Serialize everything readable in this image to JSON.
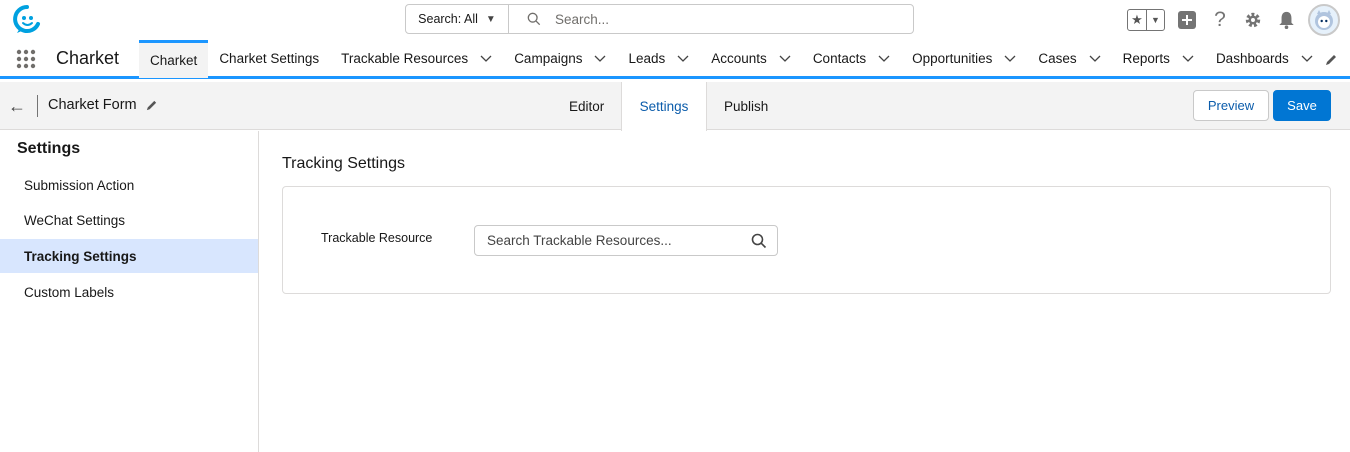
{
  "global_header": {
    "search_scope": "Search: All",
    "search_placeholder": "Search...",
    "icons": [
      "favorites-star-icon",
      "favorites-dropdown-icon",
      "global-add-icon",
      "help-icon",
      "setup-gear-icon",
      "notifications-bell-icon",
      "user-avatar"
    ]
  },
  "nav": {
    "app_name": "Charket",
    "items": [
      {
        "label": "Charket",
        "active": true,
        "dropdown": false
      },
      {
        "label": "Charket Settings",
        "dropdown": false
      },
      {
        "label": "Trackable Resources",
        "dropdown": true
      },
      {
        "label": "Campaigns",
        "dropdown": true
      },
      {
        "label": "Leads",
        "dropdown": true
      },
      {
        "label": "Accounts",
        "dropdown": true
      },
      {
        "label": "Contacts",
        "dropdown": true
      },
      {
        "label": "Opportunities",
        "dropdown": true
      },
      {
        "label": "Cases",
        "dropdown": true
      },
      {
        "label": "Reports",
        "dropdown": true
      },
      {
        "label": "Dashboards",
        "dropdown": true
      }
    ]
  },
  "builder": {
    "form_title": "Charket Form",
    "tabs": {
      "editor": "Editor",
      "settings": "Settings",
      "publish": "Publish"
    },
    "active_tab": "Settings",
    "preview_label": "Preview",
    "save_label": "Save"
  },
  "sidebar": {
    "heading": "Settings",
    "items": [
      {
        "label": "Submission Action"
      },
      {
        "label": "WeChat Settings"
      },
      {
        "label": "Tracking Settings",
        "active": true
      },
      {
        "label": "Custom Labels"
      }
    ]
  },
  "main": {
    "title": "Tracking Settings",
    "field_label": "Trackable Resource",
    "lookup_placeholder": "Search Trackable Resources..."
  },
  "colors": {
    "brand_blue": "#0176d3",
    "nav_accent": "#1b96ff",
    "active_sidebar": "#d8e6fe",
    "logo": "#00a1e0"
  }
}
